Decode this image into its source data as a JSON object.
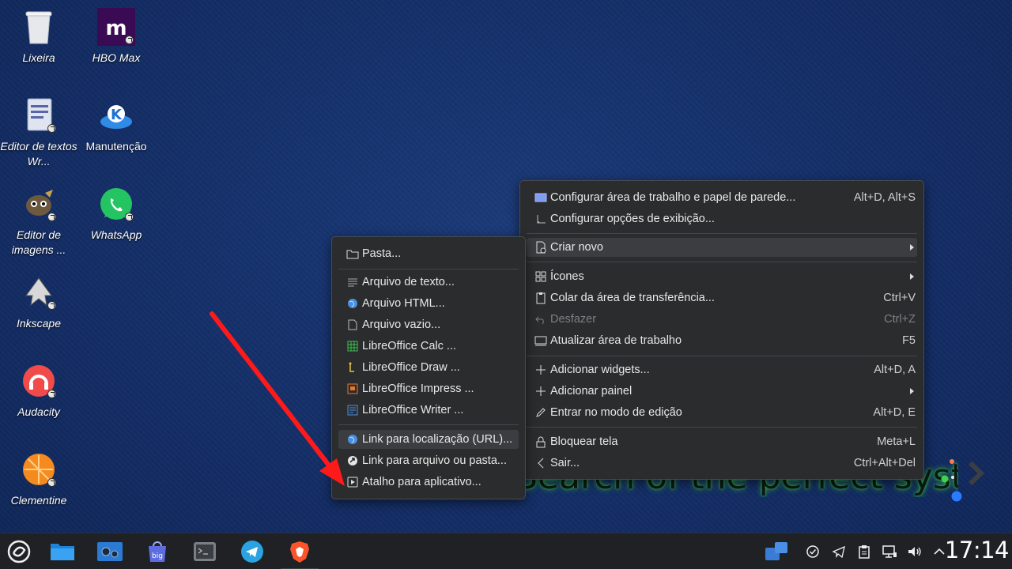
{
  "desktop": {
    "icons": [
      {
        "label": "Lixeira"
      },
      {
        "label": "HBO Max"
      },
      {
        "label": "Editor de textos Wr..."
      },
      {
        "label": "Manutenção"
      },
      {
        "label": "Editor de imagens ..."
      },
      {
        "label": "WhatsApp"
      },
      {
        "label": "Inkscape"
      },
      {
        "label": "Audacity"
      },
      {
        "label": "Clementine"
      }
    ],
    "wallpaper_text": "Search of the perfect system"
  },
  "context_menu": {
    "items": [
      {
        "label": "Configurar área de trabalho e papel de parede...",
        "shortcut": "Alt+D, Alt+S",
        "icon": "wallpaper-icon"
      },
      {
        "label": "Configurar opções de exibição...",
        "shortcut": "",
        "icon": "display-options-icon"
      },
      {
        "label": "Criar novo",
        "shortcut": "",
        "icon": "new-document-icon",
        "submenu": true
      },
      {
        "label": "Ícones",
        "shortcut": "",
        "icon": "grid-icon",
        "submenu": true
      },
      {
        "label": "Colar da área de transferência...",
        "shortcut": "Ctrl+V",
        "icon": "clipboard-icon"
      },
      {
        "label": "Desfazer",
        "shortcut": "Ctrl+Z",
        "icon": "undo-icon",
        "disabled": true
      },
      {
        "label": "Atualizar área de trabalho",
        "shortcut": "F5",
        "icon": "monitor-icon"
      },
      {
        "label": "Adicionar widgets...",
        "shortcut": "Alt+D, A",
        "icon": "plus-icon"
      },
      {
        "label": "Adicionar painel",
        "shortcut": "",
        "icon": "plus-icon",
        "submenu": true
      },
      {
        "label": "Entrar no modo de edição",
        "shortcut": "Alt+D, E",
        "icon": "pencil-icon"
      },
      {
        "label": "Bloquear tela",
        "shortcut": "Meta+L",
        "icon": "lock-icon"
      },
      {
        "label": "Sair...",
        "shortcut": "Ctrl+Alt+Del",
        "icon": "chevron-left-icon"
      }
    ]
  },
  "create_new_submenu": {
    "items": [
      {
        "label": "Pasta...",
        "icon": "folder-icon"
      },
      {
        "label": "Arquivo de texto...",
        "icon": "text-file-icon"
      },
      {
        "label": "Arquivo HTML...",
        "icon": "globe-icon"
      },
      {
        "label": "Arquivo vazio...",
        "icon": "empty-file-icon"
      },
      {
        "label": "LibreOffice Calc  ...",
        "icon": "calc-icon"
      },
      {
        "label": "LibreOffice Draw  ...",
        "icon": "draw-icon"
      },
      {
        "label": "LibreOffice Impress  ...",
        "icon": "impress-icon"
      },
      {
        "label": "LibreOffice Writer  ...",
        "icon": "writer-icon"
      },
      {
        "label": "Link para localização (URL)...",
        "icon": "globe-icon"
      },
      {
        "label": "Link para arquivo ou pasta...",
        "icon": "link-icon"
      },
      {
        "label": "Atalho para aplicativo...",
        "icon": "app-shortcut-icon"
      }
    ]
  },
  "taskbar": {
    "launchers": [
      "app-launcher",
      "file-manager",
      "system-settings",
      "big-store",
      "terminal",
      "telegram",
      "brave-browser"
    ],
    "clock": "17:14"
  },
  "colors": {
    "accent_red": "#ff1a1a",
    "menu_bg": "#2b2c2e",
    "wallpaper": "#15306a"
  }
}
